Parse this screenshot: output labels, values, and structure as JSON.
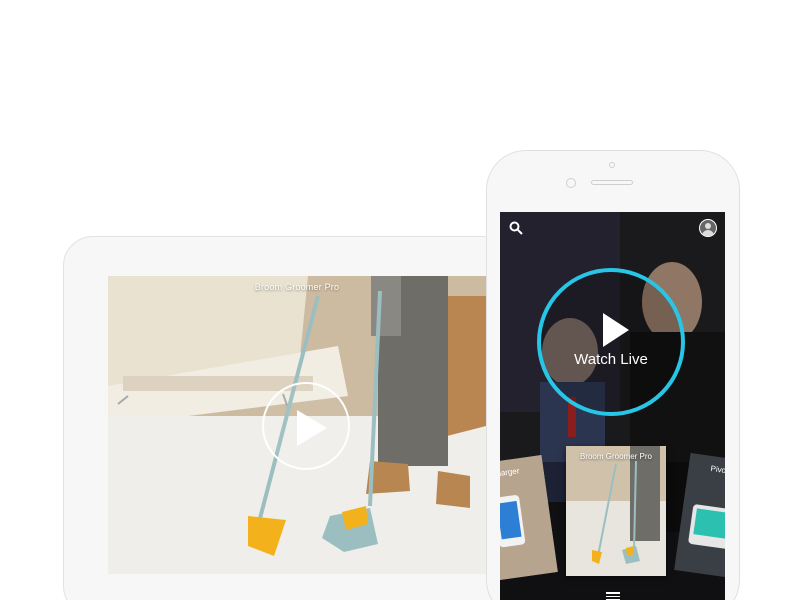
{
  "tablet": {
    "video_title": "Broom Groomer Pro"
  },
  "phone": {
    "watch_live_label": "Watch Live",
    "carousel": [
      {
        "title": "Charger"
      },
      {
        "title": "Broom Groomer Pro"
      },
      {
        "title": "Pivo"
      }
    ]
  },
  "colors": {
    "accent": "#28c6e6",
    "broom_yellow": "#f3b21c",
    "broom_teal": "#9bbfc0"
  },
  "icons": [
    "search-icon",
    "avatar",
    "play-icon",
    "menu-icon"
  ]
}
